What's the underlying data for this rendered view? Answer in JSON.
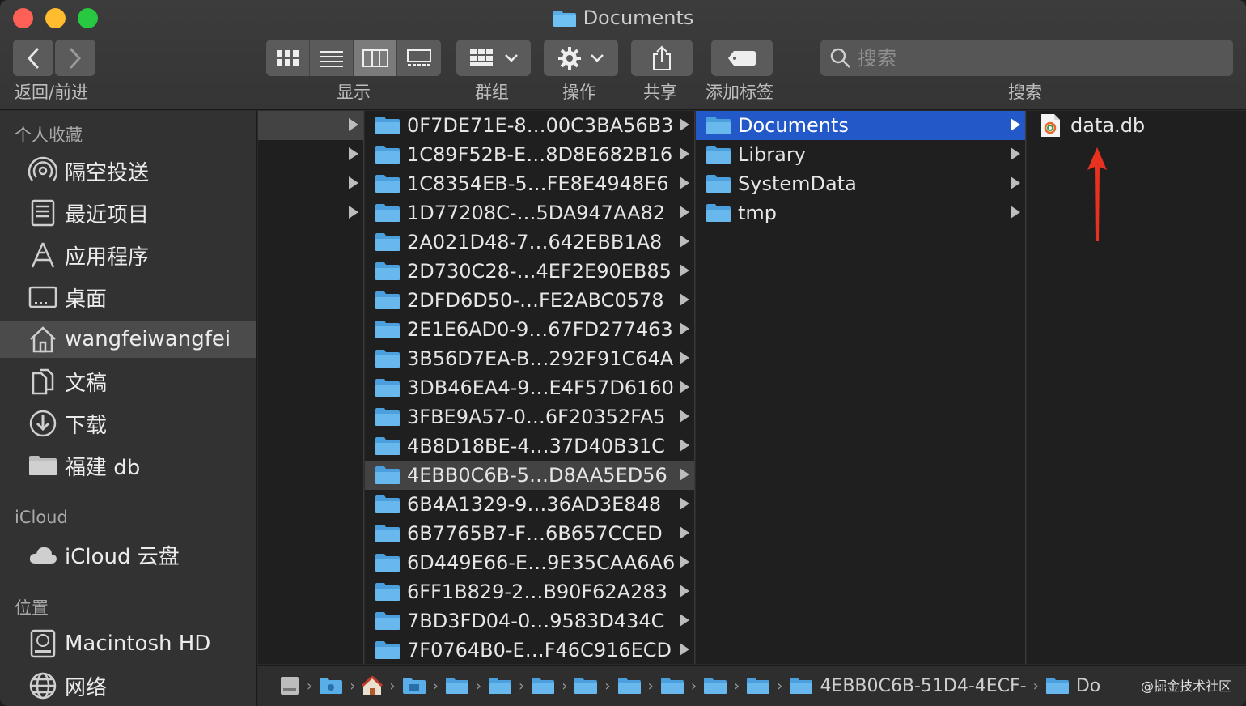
{
  "window": {
    "title": "Documents"
  },
  "toolbar": {
    "nav_label": "返回/前进",
    "view_label": "显示",
    "group_label": "群组",
    "action_label": "操作",
    "share_label": "共享",
    "tag_label": "添加标签",
    "search_label": "搜索",
    "search_placeholder": "搜索"
  },
  "sidebar": {
    "favorites_header": "个人收藏",
    "favorites": [
      {
        "label": "隔空投送",
        "icon": "airdrop-icon"
      },
      {
        "label": "最近项目",
        "icon": "recents-icon"
      },
      {
        "label": "应用程序",
        "icon": "applications-icon"
      },
      {
        "label": "桌面",
        "icon": "desktop-icon"
      },
      {
        "label": "wangfeiwangfei",
        "icon": "home-icon"
      },
      {
        "label": "文稿",
        "icon": "documents-icon"
      },
      {
        "label": "下载",
        "icon": "downloads-icon"
      },
      {
        "label": "福建 db",
        "icon": "folder-icon"
      }
    ],
    "icloud_header": "iCloud",
    "icloud": [
      {
        "label": "iCloud 云盘",
        "icon": "cloud-icon"
      }
    ],
    "locations_header": "位置",
    "locations": [
      {
        "label": "Macintosh HD",
        "icon": "disk-icon"
      },
      {
        "label": "网络",
        "icon": "network-icon"
      }
    ]
  },
  "column2": {
    "items": [
      "0F7DE71E-8…00C3BA56B3",
      "1C89F52B-E…8D8E682B16",
      "1C8354EB-5…FE8E4948E6",
      "1D77208C-…5DA947AA82",
      "2A021D48-7…642EBB1A8",
      "2D730C28-…4EF2E90EB85",
      "2DFD6D50-…FE2ABC0578",
      "2E1E6AD0-9…67FD277463",
      "3B56D7EA-B…292F91C64A",
      "3DB46EA4-9…E4F57D6160",
      "3FBE9A57-0…6F20352FA5",
      "4B8D18BE-4…37D40B31C",
      "4EBB0C6B-5…D8AA5ED56",
      "6B4A1329-9…36AD3E848",
      "6B7765B7-F…6B657CCED",
      "6D449E66-E…9E35CAA6A6",
      "6FF1B829-2…B90F62A283",
      "7BD3FD04-0…9583D434C",
      "7F0764B0-E…F46C916ECD"
    ]
  },
  "column3": {
    "items": [
      "Documents",
      "Library",
      "SystemData",
      "tmp"
    ]
  },
  "column4": {
    "items": [
      "data.db"
    ]
  },
  "pathbar": {
    "segment_long": "4EBB0C6B-51D4-4ECF-",
    "segment_last": "Do"
  },
  "watermark": "@掘金技术社区",
  "colors": {
    "selection": "#2358c9",
    "folder": "#5aaee8",
    "annotation_arrow": "#e8321f"
  }
}
